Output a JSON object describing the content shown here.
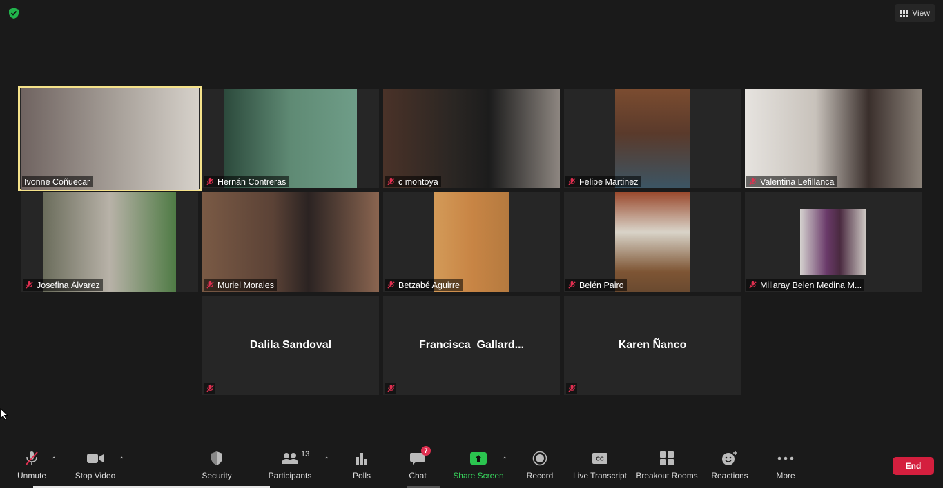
{
  "top": {
    "view_label": "View"
  },
  "participants": [
    {
      "name": "Ivonne Coñuecar",
      "muted": false,
      "active": true,
      "video_color": "#8a7a74"
    },
    {
      "name": "Hernán Contreras",
      "muted": true,
      "active": false,
      "video_color": "#3f5e4f"
    },
    {
      "name": "c montoya",
      "muted": true,
      "active": false,
      "video_color": "#3a332f"
    },
    {
      "name": "Felipe Martinez",
      "muted": true,
      "active": false,
      "video_color": "#6f4d3a"
    },
    {
      "name": "Valentina Lefillanca",
      "muted": true,
      "active": false,
      "video_color": "#b7b3ae"
    },
    {
      "name": "Josefina Álvarez",
      "muted": true,
      "active": false,
      "video_color": "#7d7c6a"
    },
    {
      "name": "Muriel Morales",
      "muted": true,
      "active": false,
      "video_color": "#6a4c3c"
    },
    {
      "name": "Betzabé Aguirre",
      "muted": true,
      "active": false,
      "video_color": "#c98a4a"
    },
    {
      "name": "Belén Pairo",
      "muted": true,
      "active": false,
      "video_color": "#8a6a50"
    },
    {
      "name": "Millaray Belen Medina M...",
      "muted": true,
      "active": false,
      "video_color": "#c9c6c3"
    },
    {
      "name": "Dalila Sandoval",
      "muted": true,
      "active": false,
      "video_color": null
    },
    {
      "name": "Francisca  Gallard...",
      "muted": true,
      "active": false,
      "video_color": null
    },
    {
      "name": "Karen Ñanco",
      "muted": true,
      "active": false,
      "video_color": null
    }
  ],
  "toolbar": {
    "unmute": "Unmute",
    "stop_video": "Stop Video",
    "security": "Security",
    "participants": "Participants",
    "participants_count": "13",
    "polls": "Polls",
    "chat": "Chat",
    "chat_badge": "7",
    "share_screen": "Share Screen",
    "record": "Record",
    "live_transcript": "Live Transcript",
    "breakout_rooms": "Breakout Rooms",
    "reactions": "Reactions",
    "more": "More",
    "end": "End"
  },
  "icons": {
    "shield": "shield-icon",
    "mute": "mic-muted-icon"
  },
  "colors": {
    "active_border": "#f5e28a",
    "end_button": "#d41f3e",
    "share_green": "#38d65d",
    "mute_red": "#e02f50"
  }
}
